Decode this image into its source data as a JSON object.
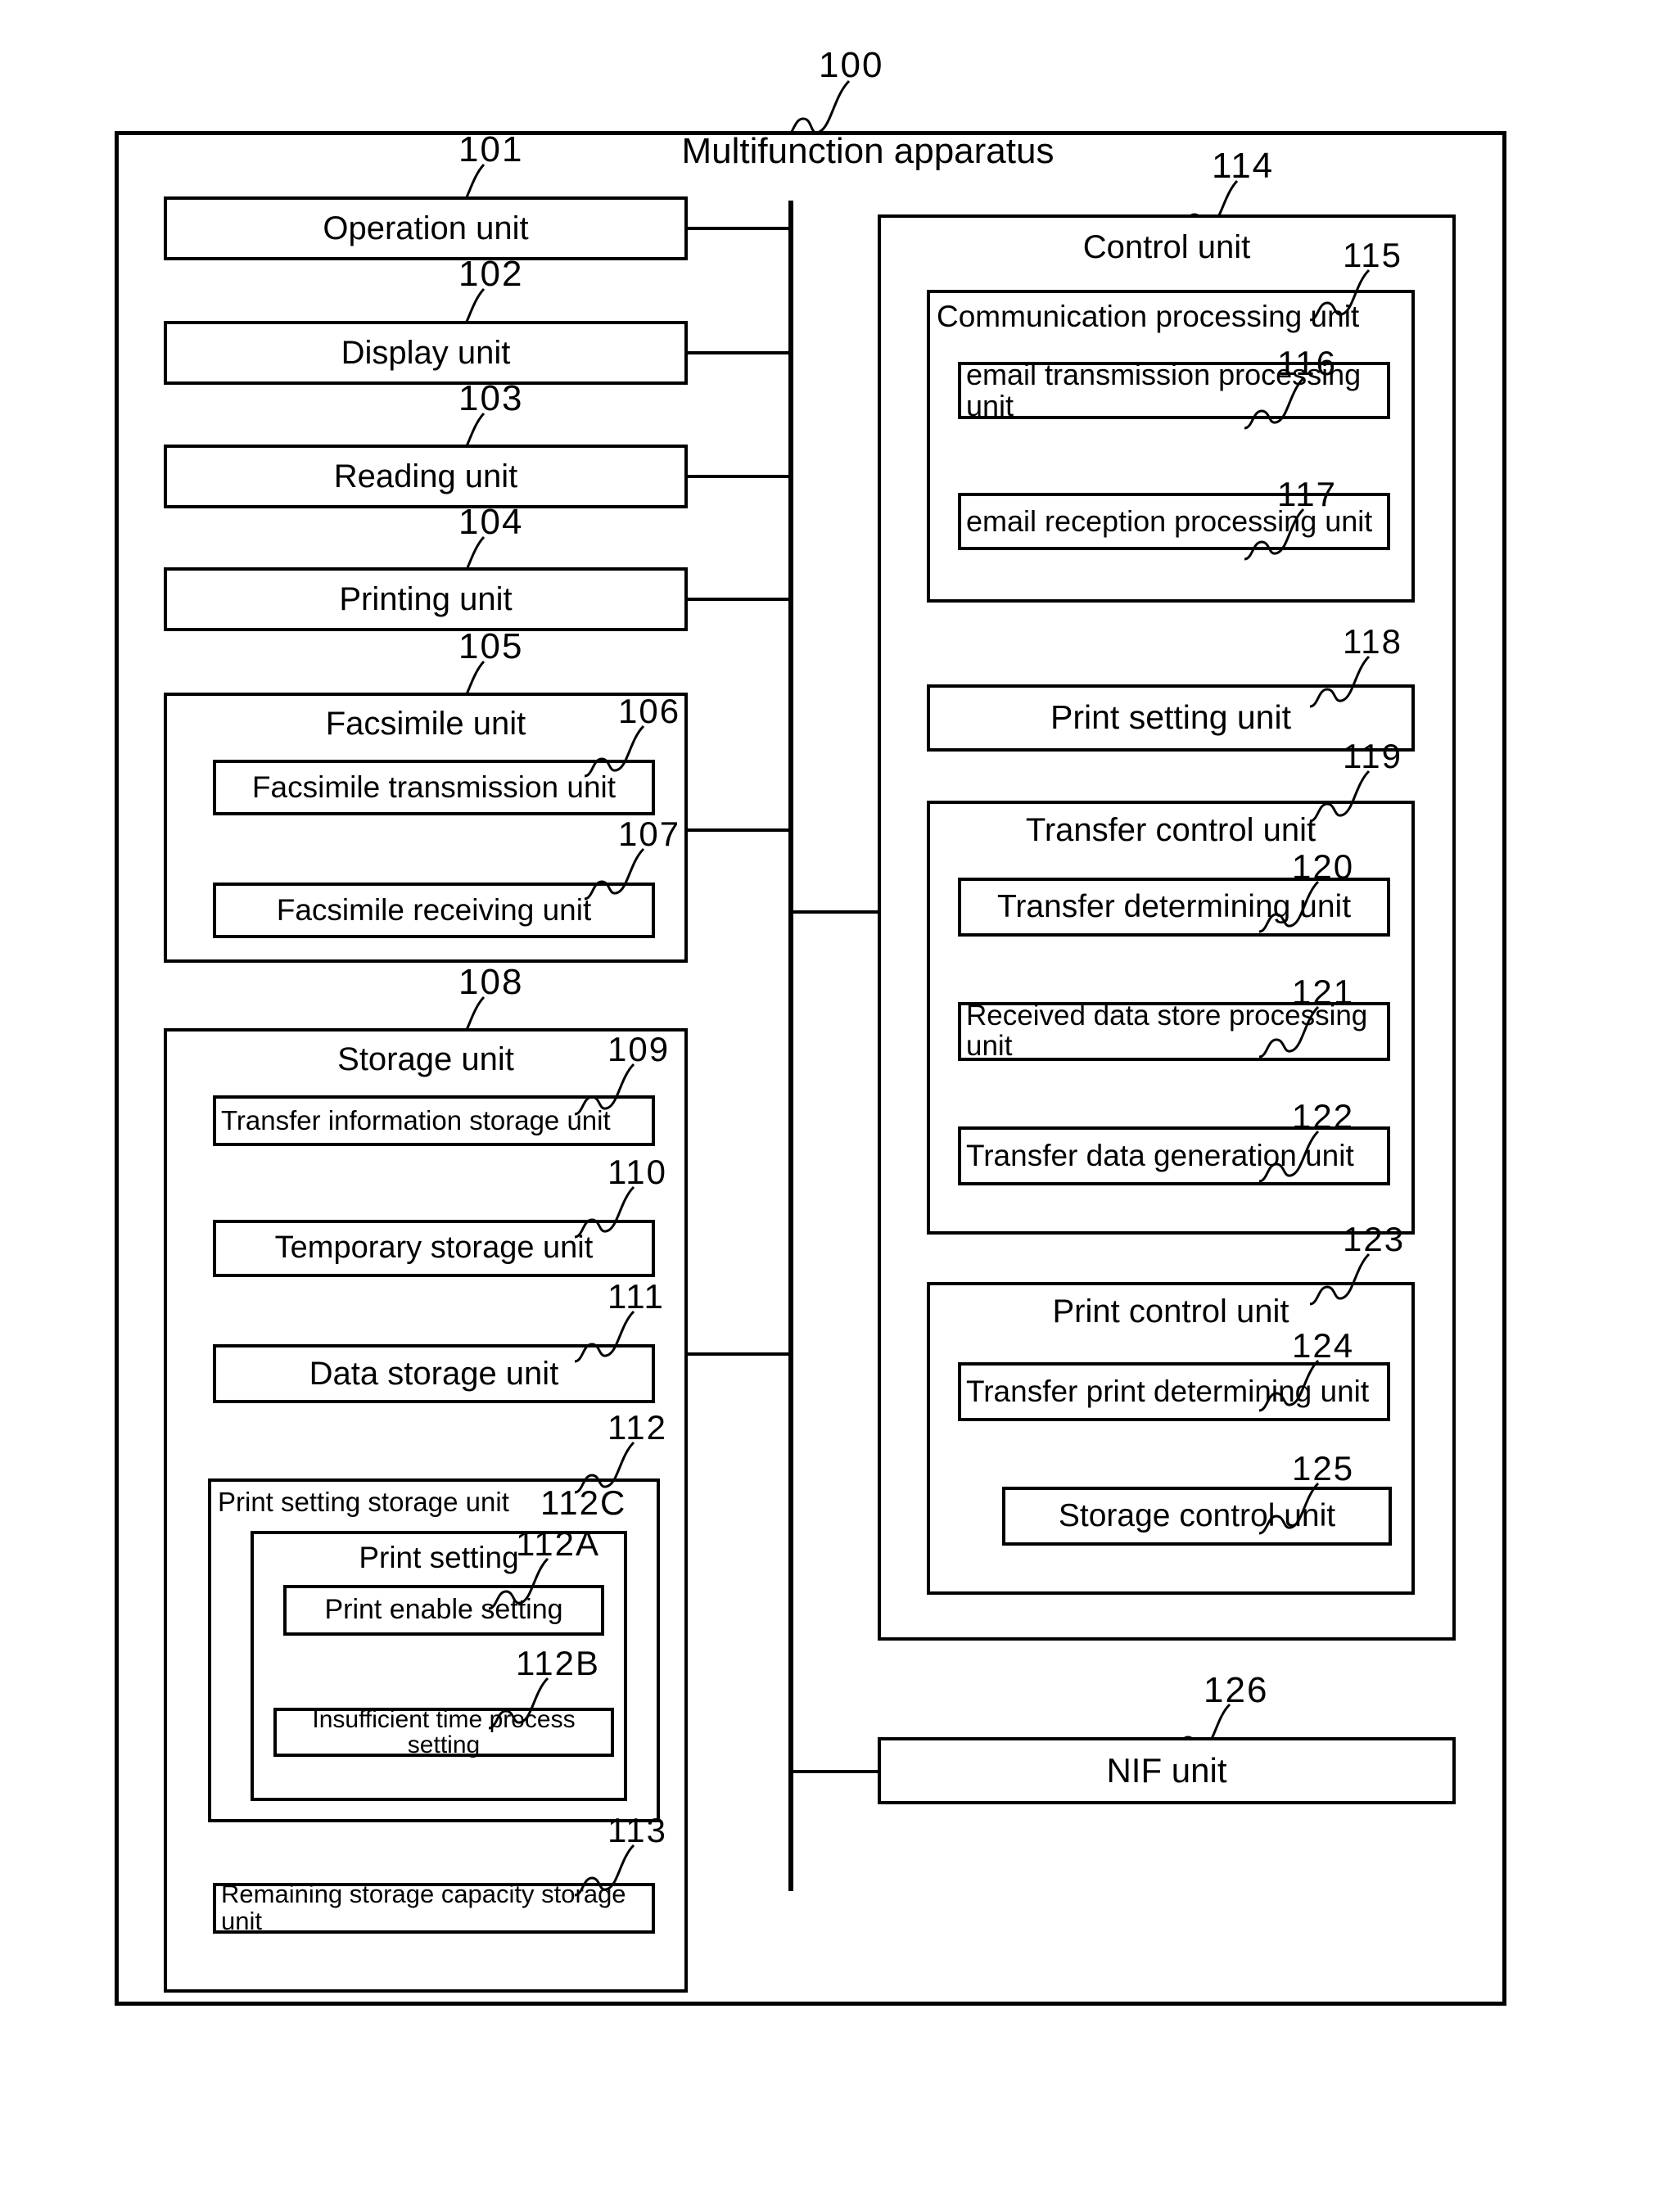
{
  "figure": {
    "apparatus_title": "Multifunction apparatus",
    "apparatus_ref": "100"
  },
  "left_column": {
    "operation_unit": {
      "label": "Operation unit",
      "ref": "101"
    },
    "display_unit": {
      "label": "Display unit",
      "ref": "102"
    },
    "reading_unit": {
      "label": "Reading unit",
      "ref": "103"
    },
    "printing_unit": {
      "label": "Printing unit",
      "ref": "104"
    },
    "facsimile_unit": {
      "label": "Facsimile unit",
      "ref": "105",
      "children": [
        {
          "label": "Facsimile transmission unit",
          "ref": "106"
        },
        {
          "label": "Facsimile receiving unit",
          "ref": "107"
        }
      ]
    },
    "storage_unit": {
      "label": "Storage unit",
      "ref": "108",
      "children": [
        {
          "label": "Transfer information storage unit",
          "ref": "109"
        },
        {
          "label": "Temporary storage unit",
          "ref": "110"
        },
        {
          "label": "Data storage unit",
          "ref": "111"
        }
      ],
      "print_setting_storage_unit": {
        "label": "Print setting storage unit",
        "ref": "112",
        "print_setting": {
          "label": "Print setting",
          "ref": "112C",
          "children": [
            {
              "label": "Print enable setting",
              "ref": "112A"
            },
            {
              "label": "Insufficient time process setting",
              "ref": "112B"
            }
          ]
        }
      },
      "remaining_capacity": {
        "label": "Remaining storage capacity storage unit",
        "ref": "113"
      }
    }
  },
  "right_column": {
    "control_unit": {
      "label": "Control unit",
      "ref": "114",
      "communication_processing_unit": {
        "label": "Communication processing unit",
        "ref": "115",
        "children": [
          {
            "label": "email transmission processing unit",
            "ref": "116"
          },
          {
            "label": "email reception processing unit",
            "ref": "117"
          }
        ]
      },
      "print_setting_unit": {
        "label": "Print setting unit",
        "ref": "118"
      },
      "transfer_control_unit": {
        "label": "Transfer control unit",
        "ref": "119",
        "children": [
          {
            "label": "Transfer determining unit",
            "ref": "120"
          },
          {
            "label": "Received data store processing unit",
            "ref": "121"
          },
          {
            "label": "Transfer data generation unit",
            "ref": "122"
          }
        ]
      },
      "print_control_unit": {
        "label": "Print control unit",
        "ref": "123",
        "children": [
          {
            "label": "Transfer print determining unit",
            "ref": "124"
          },
          {
            "label": "Storage control unit",
            "ref": "125"
          }
        ]
      }
    },
    "nif_unit": {
      "label": "NIF unit",
      "ref": "126"
    }
  }
}
